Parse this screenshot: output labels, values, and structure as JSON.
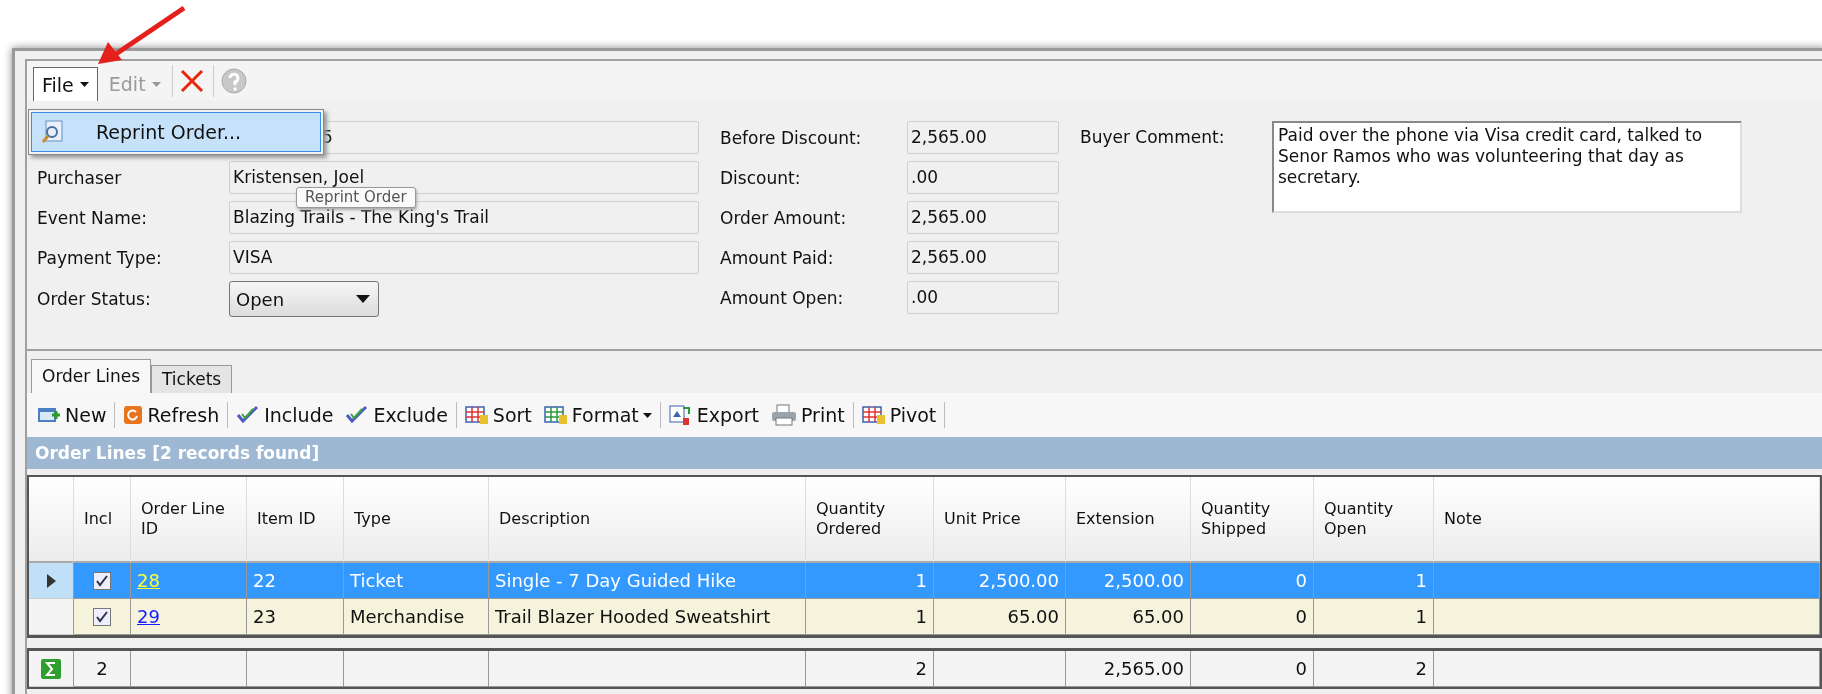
{
  "menu": {
    "items": [
      {
        "label": "File",
        "kind": "menu",
        "disabled": false,
        "selected": true
      },
      {
        "label": "Edit",
        "kind": "menu",
        "disabled": true,
        "selected": false
      },
      {
        "kind": "delete",
        "disabled": false
      },
      {
        "kind": "help",
        "disabled": true
      }
    ],
    "dropdown": [
      {
        "label": "Reprint Order...",
        "selected": true
      }
    ],
    "tooltip": "Reprint Order"
  },
  "order_fields": [
    {
      "value": "5",
      "covered": true
    },
    {
      "label": "Purchaser",
      "value": "Kristensen, Joel",
      "kind": "text"
    },
    {
      "label": "Event Name:",
      "value": "Blazing Trails - The King's Trail",
      "kind": "text"
    },
    {
      "label": "Payment Type:",
      "value": "VISA",
      "kind": "text"
    },
    {
      "label": "Order Status:",
      "value": "Open",
      "kind": "select"
    }
  ],
  "amount_fields": [
    {
      "label": "Before Discount:",
      "value": "2,565.00"
    },
    {
      "label": "Discount:",
      "value": ".00"
    },
    {
      "label": "Order Amount:",
      "value": "2,565.00"
    },
    {
      "label": "Amount Paid:",
      "value": "2,565.00"
    },
    {
      "label": "Amount Open:",
      "value": ".00"
    }
  ],
  "buyer_comment": {
    "label": "Buyer Comment:",
    "value": "Paid over the phone via Visa credit card, talked to Senor Ramos who was volunteering that day as secretary."
  },
  "tabs": [
    {
      "label": "Order Lines",
      "selected": true
    },
    {
      "label": "Tickets",
      "selected": false
    }
  ],
  "toolbar": [
    [
      {
        "label": "New"
      }
    ],
    [
      {
        "label": "Refresh"
      }
    ],
    [
      {
        "label": "Include"
      },
      {
        "label": "Exclude"
      }
    ],
    [
      {
        "label": "Sort"
      },
      {
        "label": "Format",
        "dropdown": true
      }
    ],
    [
      {
        "label": "Export"
      },
      {
        "label": "Print"
      }
    ],
    [
      {
        "label": "Pivot"
      }
    ]
  ],
  "grid": {
    "caption": "Order Lines [2 records found]",
    "columns": [
      "Incl",
      "Order Line ID",
      "Item ID",
      "Type",
      "Description",
      "Quantity Ordered",
      "Unit Price",
      "Extension",
      "Quantity Shipped",
      "Quantity Open",
      "Note"
    ],
    "rows": [
      {
        "selected": true,
        "checked": true,
        "cells": [
          "",
          "28",
          "22",
          "Ticket",
          "Single - 7 Day Guided Hike",
          "1",
          "2,500.00",
          "2,500.00",
          "0",
          "1",
          ""
        ]
      },
      {
        "selected": false,
        "checked": true,
        "cells": [
          "",
          "29",
          "23",
          "Merchandise",
          "Trail Blazer Hooded Sweatshirt",
          "1",
          "65.00",
          "65.00",
          "0",
          "1",
          ""
        ]
      }
    ],
    "totals": {
      "count": "2",
      "quantity_ordered": "2",
      "extension": "2,565.00",
      "quantity_shipped": "0",
      "quantity_open": "2"
    }
  }
}
